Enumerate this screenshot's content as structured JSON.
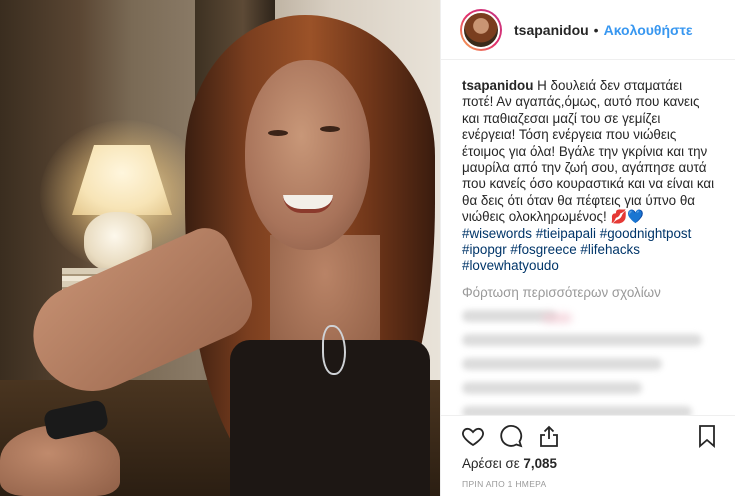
{
  "header": {
    "username": "tsapanidou",
    "separator": "•",
    "follow_label": "Ακολουθήστε"
  },
  "caption": {
    "username": "tsapanidou",
    "text": "Η δουλειά δεν σταματάει ποτέ! Αν αγαπάς,όμως, αυτό που κανεις και παθιαζεσαι μαζί του σε γεμίζει ενέργεια! Τόση ενέργεια που νιώθεις έτοιμος για όλα! Βγάλε την γκρίνια και την μαυρίλα από την ζωή σου, αγάπησε αυτά που κανείς όσο κουραστικά και να είναι και θα δεις ότι όταν θα πέφτεις για ύπνο θα νιώθεις ολοκληρωμένος! 💋💙",
    "hashtags": [
      "#wisewords",
      "#tieipapali",
      "#goodnightpost",
      "#ipopgr",
      "#fosgreece",
      "#lifehacks",
      "#lovewhatyoudo"
    ]
  },
  "comments": {
    "load_more_label": "Φόρτωση περισσότερων σχολίων"
  },
  "actions": {
    "like_icon": "heart-icon",
    "comment_icon": "comment-icon",
    "share_icon": "share-icon",
    "save_icon": "bookmark-icon"
  },
  "likes": {
    "prefix": "Αρέσει σε",
    "count": "7,085"
  },
  "timestamp": "ΠΡΙΝ ΑΠΟ 1 ΗΜΕΡΑ",
  "colors": {
    "link_blue": "#3897f0",
    "hashtag_blue": "#003569",
    "text": "#262626",
    "muted": "#999999"
  }
}
